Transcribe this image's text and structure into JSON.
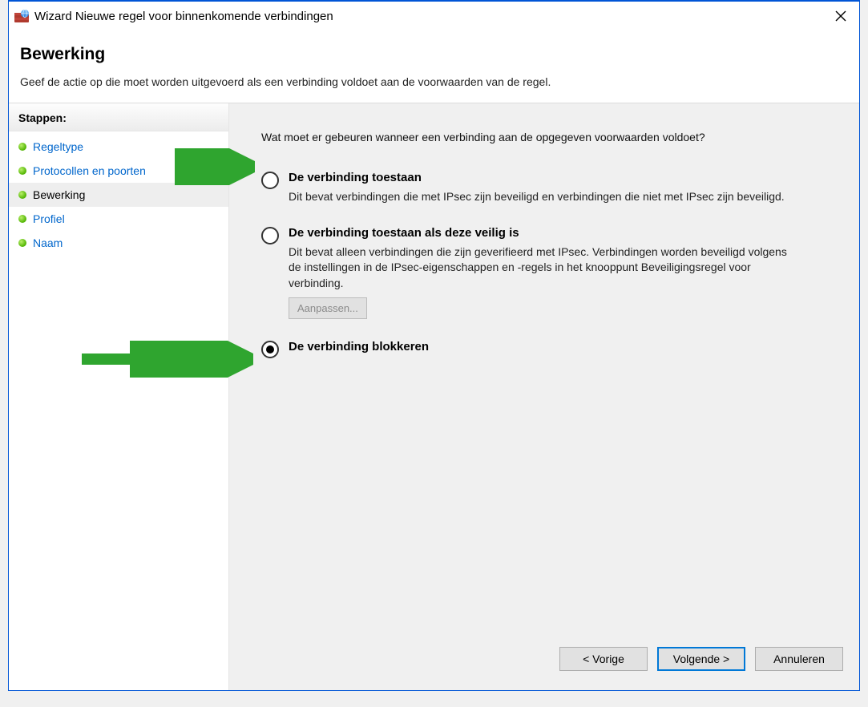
{
  "window": {
    "title": "Wizard Nieuwe regel voor binnenkomende verbindingen"
  },
  "header": {
    "title": "Bewerking",
    "description": "Geef de actie op die moet worden uitgevoerd als een verbinding voldoet aan de voorwaarden van de regel."
  },
  "sidebar": {
    "title": "Stappen:",
    "items": [
      {
        "label": "Regeltype",
        "current": false
      },
      {
        "label": "Protocollen en poorten",
        "current": false
      },
      {
        "label": "Bewerking",
        "current": true
      },
      {
        "label": "Profiel",
        "current": false
      },
      {
        "label": "Naam",
        "current": false
      }
    ]
  },
  "content": {
    "question": "Wat moet er gebeuren wanneer een verbinding aan de opgegeven voorwaarden voldoet?",
    "options": [
      {
        "title": "De verbinding toestaan",
        "desc": "Dit bevat verbindingen die met IPsec zijn beveiligd en verbindingen die niet met IPsec zijn beveiligd.",
        "checked": false,
        "customize_label": null
      },
      {
        "title": "De verbinding toestaan als deze veilig is",
        "desc": "Dit bevat alleen verbindingen die zijn geverifieerd met IPsec. Verbindingen worden beveiligd volgens de instellingen in de IPsec-eigenschappen en -regels in het knooppunt Beveiligingsregel voor verbinding.",
        "checked": false,
        "customize_label": "Aanpassen..."
      },
      {
        "title": "De verbinding blokkeren",
        "desc": null,
        "checked": true,
        "customize_label": null
      }
    ]
  },
  "buttons": {
    "back": "< Vorige",
    "next": "Volgende >",
    "cancel": "Annuleren"
  }
}
